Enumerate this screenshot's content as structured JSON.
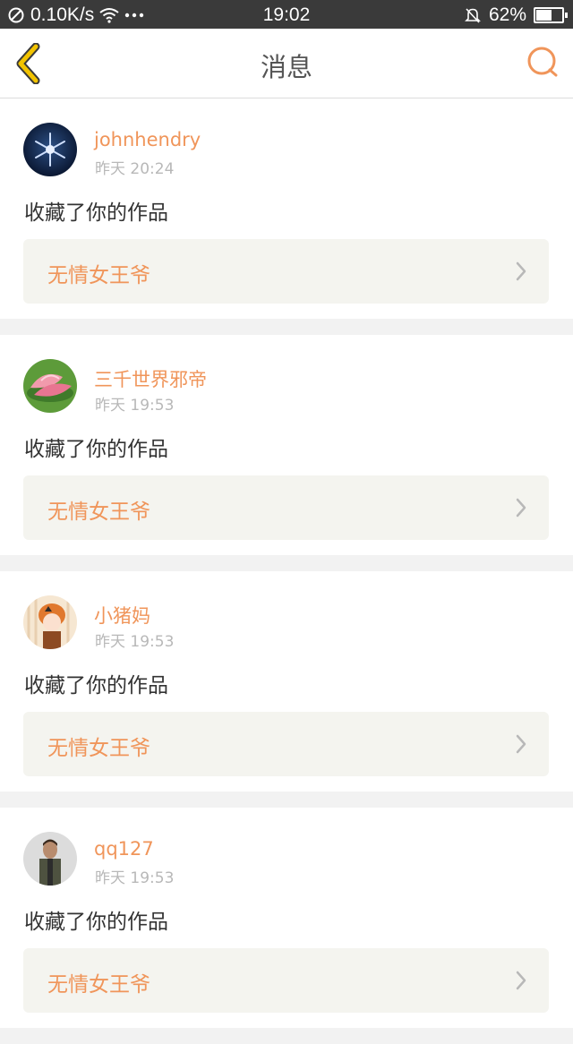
{
  "status_bar": {
    "network_speed": "0.10K/s",
    "time": "19:02",
    "battery_level": "62%",
    "battery_fraction": 0.62
  },
  "nav": {
    "title": "消息",
    "back_icon": "chevron-left-icon",
    "search_icon": "search-icon",
    "accent_color": "#f0955a",
    "back_color": "#f2c300"
  },
  "messages": [
    {
      "username": "johnhendry",
      "time": "昨天 20:24",
      "action": "收藏了你的作品",
      "work_title": "无情女王爷"
    },
    {
      "username": "三千世界邪帝",
      "time": "昨天 19:53",
      "action": "收藏了你的作品",
      "work_title": "无情女王爷"
    },
    {
      "username": "小猪妈",
      "time": "昨天 19:53",
      "action": "收藏了你的作品",
      "work_title": "无情女王爷"
    },
    {
      "username": "qq127",
      "time": "昨天 19:53",
      "action": "收藏了你的作品",
      "work_title": "无情女王爷"
    }
  ]
}
